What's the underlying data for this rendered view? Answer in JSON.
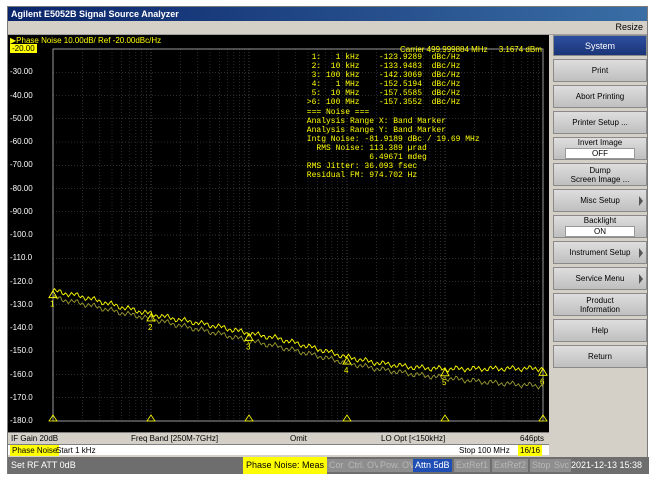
{
  "window": {
    "title": "Agilent E5052B Signal Source Analyzer",
    "resize_label": "Resize"
  },
  "trace": {
    "title": "Phase Noise 10.00dB/ Ref -20.00dBc/Hz",
    "carrier": "Carrier 499.999884 MHz     3.1674 dBm"
  },
  "marker_table": [
    "  1:   1 kHz    -123.9289  dBc/Hz",
    "  2:  10 kHz    -133.9483  dBc/Hz",
    "  3: 100 kHz    -142.3069  dBc/Hz",
    "  4:   1 MHz    -152.5194  dBc/Hz",
    "  5:  10 MHz    -157.5585  dBc/Hz",
    " >6: 100 MHz    -157.3552  dBc/Hz",
    " === Noise ===",
    " Analysis Range X: Band Marker",
    " Analysis Range Y: Band Marker",
    " Intg Noise: -81.9189 dBc / 19.69 MHz",
    "   RMS Noise: 113.389 µrad",
    "              6.49671 mdeg",
    " RMS Jitter: 36.093 fsec",
    " Residual FM: 974.702 Hz"
  ],
  "chart_data": {
    "type": "line",
    "xscale": "log",
    "xlim": [
      1000,
      100000000
    ],
    "ylim": [
      -180,
      -20
    ],
    "grid": true,
    "ytick_labels": [
      "-20.00",
      "-30.00",
      "-40.00",
      "-50.00",
      "-60.00",
      "-70.00",
      "-80.00",
      "-90.00",
      "-100.0",
      "-110.0",
      "-120.0",
      "-130.0",
      "-140.0",
      "-150.0",
      "-160.0",
      "-170.0",
      "-180.0"
    ],
    "series": [
      {
        "color": "#ffff00",
        "x": [
          1000,
          2000,
          5000,
          10000,
          20000,
          50000,
          100000,
          200000,
          500000,
          1000000,
          2000000,
          5000000,
          10000000,
          30000000,
          100000000
        ],
        "y": [
          -124,
          -126.5,
          -131,
          -134,
          -136.5,
          -139.5,
          -142.3,
          -144.5,
          -149,
          -152.5,
          -155,
          -157,
          -157.6,
          -157.5,
          -157.4
        ]
      },
      {
        "color": "#9a9a30",
        "x": [
          1000,
          2000,
          5000,
          10000,
          20000,
          50000,
          100000,
          200000,
          500000,
          1000000,
          2000000,
          5000000,
          10000000,
          30000000,
          100000000
        ],
        "y": [
          -127,
          -129.5,
          -133.5,
          -136,
          -139,
          -142.5,
          -145.5,
          -148,
          -152,
          -155,
          -157.5,
          -160,
          -161.5,
          -163.5,
          -165
        ]
      }
    ],
    "markers": [
      {
        "label": "1",
        "x": 1000,
        "y": -123.9289
      },
      {
        "label": "2",
        "x": 10000,
        "y": -133.9483
      },
      {
        "label": "3",
        "x": 100000,
        "y": -142.3069
      },
      {
        "label": "4",
        "x": 1000000,
        "y": -152.5194
      },
      {
        "label": "5",
        "x": 10000000,
        "y": -157.5585
      },
      {
        "label": "6",
        "x": 100000000,
        "y": -157.3552
      }
    ]
  },
  "status1": {
    "if_gain": "IF Gain 20dB",
    "freq_band": "Freq Band [250M-7GHz]",
    "omit": "Omit",
    "lo_opt": "LO Opt [<150kHz]",
    "points": "646pts"
  },
  "status2": {
    "meas": "Phase Noise",
    "start": "Start 1 kHz",
    "stop": "Stop 100 MHz",
    "range": "16/16"
  },
  "bottom": {
    "rf_att": "Set RF ATT 0dB",
    "meas": "Phase Noise: Meas",
    "cor": "Cor",
    "ctrl": "Ctrl. OV",
    "pow": "Pow. OV",
    "attn": "Attn 5dB",
    "extref1": "ExtRef1",
    "extref2": "ExtRef2",
    "stop": "Stop",
    "svc": "Svc",
    "datetime": "2021-12-13 15:38"
  },
  "softkeys": {
    "header": "System",
    "print": "Print",
    "abort": "Abort Printing",
    "printer_setup": "Printer Setup ...",
    "invert_image": "Invert Image",
    "invert_state": "OFF",
    "dump1": "Dump",
    "dump2": "Screen Image ...",
    "misc": "Misc Setup",
    "backlight": "Backlight",
    "backlight_state": "ON",
    "instrument": "Instrument Setup",
    "service": "Service Menu",
    "product1": "Product",
    "product2": "Information",
    "help": "Help",
    "return": "Return"
  }
}
